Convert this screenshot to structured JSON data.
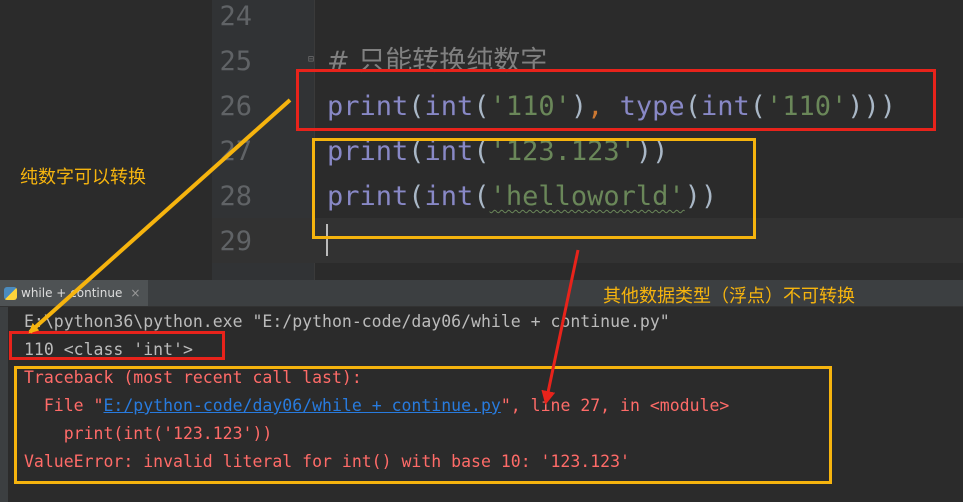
{
  "editor": {
    "lines": [
      {
        "num": "24",
        "code": ""
      },
      {
        "num": "25",
        "comment": "# 只能转换纯数字"
      },
      {
        "num": "26",
        "parts": [
          "print",
          "(",
          "int",
          "(",
          "'110'",
          ")",
          ", ",
          "type",
          "(",
          "int",
          "(",
          "'110'",
          ")))"
        ]
      },
      {
        "num": "27",
        "parts": [
          "print",
          "(",
          "int",
          "(",
          "'123.123'",
          "))"
        ]
      },
      {
        "num": "28",
        "parts": [
          "print",
          "(",
          "int",
          "(",
          "'helloworld'",
          "))"
        ]
      },
      {
        "num": "29",
        "code": ""
      }
    ]
  },
  "run_panel": {
    "tab_label": "while + continue",
    "tab_close": "×"
  },
  "console": {
    "command": "E:\\python36\\python.exe \"E:/python-code/day06/while + continue.py\"",
    "output": "110 <class 'int'>",
    "traceback": "Traceback (most recent call last):",
    "file_prefix": "  File \"",
    "file_link": "E:/python-code/day06/while + continue.py",
    "file_suffix": "\", line 27, in <module>",
    "code_line": "    print(int('123.123'))",
    "error": "ValueError: invalid literal for int() with base 10: '123.123'"
  },
  "annotations": {
    "pure_number": "纯数字可以转换",
    "other_types": "其他数据类型（浮点）不可转换"
  },
  "colors": {
    "red_box": "#e8231b",
    "yellow_box": "#f6b40e"
  }
}
